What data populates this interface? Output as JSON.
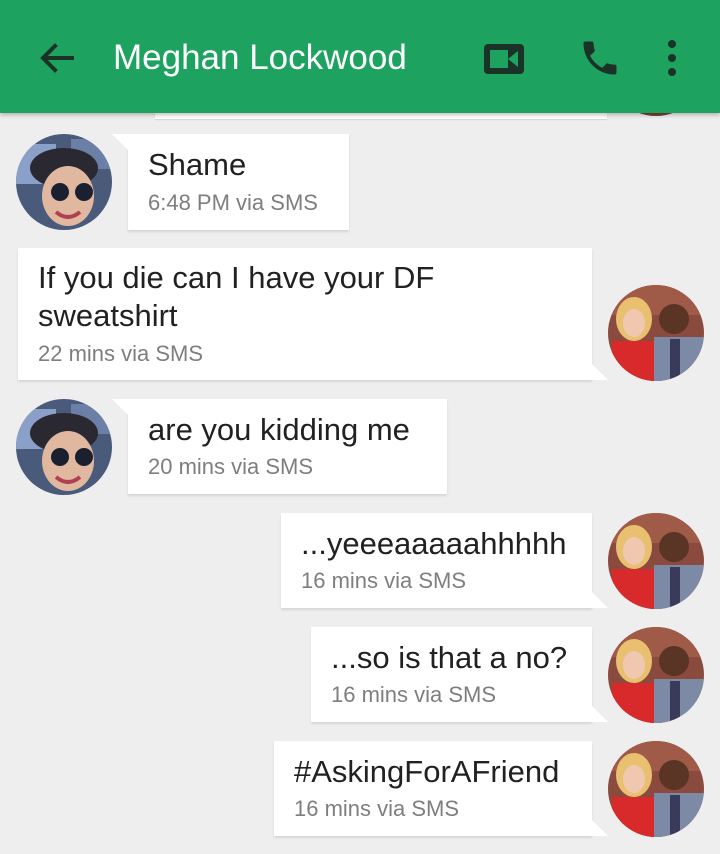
{
  "header": {
    "title": "Meghan Lockwood",
    "back_icon": "arrow-back-icon",
    "video_icon": "videocam-icon",
    "call_icon": "phone-icon",
    "menu_icon": "more-vert-icon",
    "bar_color": "#1da260"
  },
  "messages": [
    {
      "sender": "contact",
      "text": "Shame",
      "meta": "6:48 PM via SMS"
    },
    {
      "sender": "me",
      "text_lines": [
        "If you die can I have your DF",
        "sweatshirt"
      ],
      "meta": "22 mins via SMS"
    },
    {
      "sender": "contact",
      "text": "are you kidding me",
      "meta": "20 mins via SMS"
    },
    {
      "sender": "me",
      "text": "...yeeeaaaaahhhhh",
      "meta": "16 mins via SMS"
    },
    {
      "sender": "me",
      "text": "...so is that a no?",
      "meta": "16 mins via SMS"
    },
    {
      "sender": "me",
      "text": "#AskingForAFriend",
      "meta": "16 mins via SMS"
    }
  ]
}
